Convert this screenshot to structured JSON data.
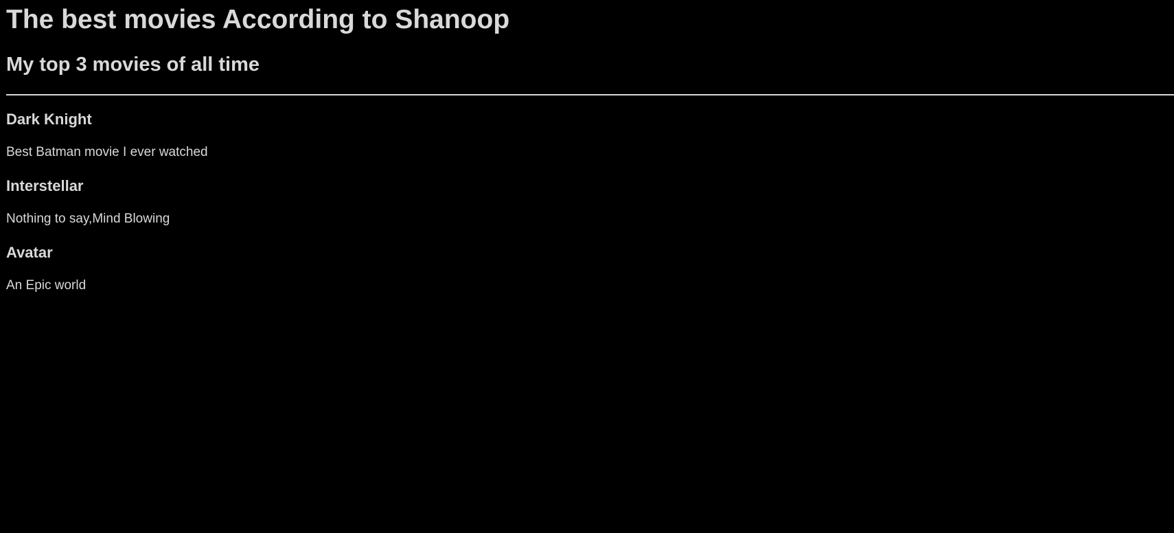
{
  "header": {
    "title": "The best movies According to Shanoop",
    "subtitle": "My top 3 movies of all time"
  },
  "movies": [
    {
      "title": "Dark Knight",
      "description": "Best Batman movie I ever watched"
    },
    {
      "title": "Interstellar",
      "description": "Nothing to say,Mind Blowing"
    },
    {
      "title": "Avatar",
      "description": "An Epic world"
    }
  ],
  "colors": {
    "background": "#000000",
    "text": "#d9d9d9"
  }
}
